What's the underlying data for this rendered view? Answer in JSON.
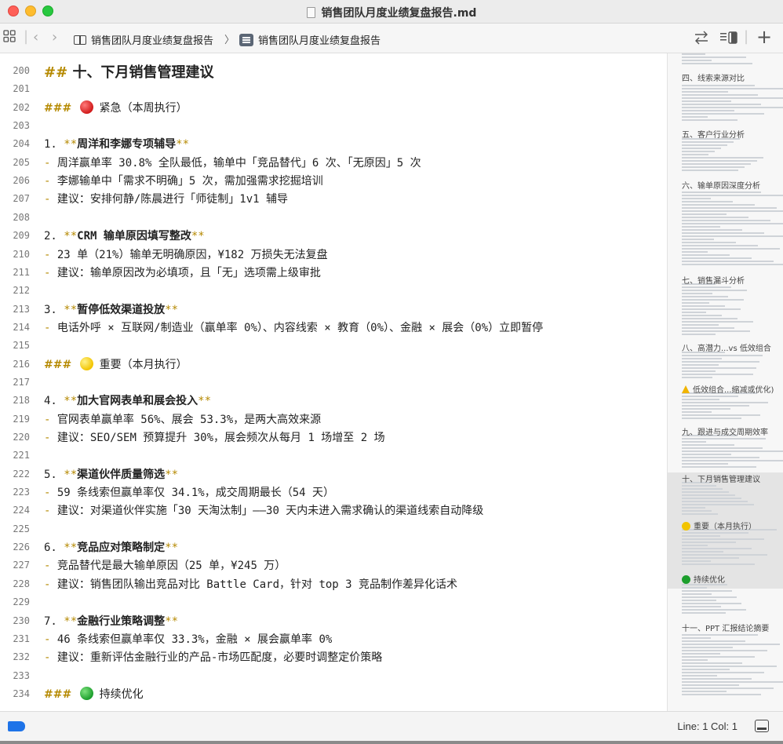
{
  "window": {
    "title": "销售团队月度业绩复盘报告.md"
  },
  "toolbar": {
    "breadcrumb_1": "销售团队月度业绩复盘报告",
    "breadcrumb_sep": "〉",
    "breadcrumb_2": "销售团队月度业绩复盘报告",
    "plus_label": "+"
  },
  "editor": {
    "lines": [
      {
        "n": "200",
        "type": "h2",
        "mark": "##",
        "text": "十、下月销售管理建议"
      },
      {
        "n": "201",
        "type": "blank"
      },
      {
        "n": "202",
        "type": "h3",
        "mark": "###",
        "dot": "red",
        "text": "紧急（本周执行）"
      },
      {
        "n": "203",
        "type": "blank"
      },
      {
        "n": "204",
        "type": "item",
        "num": "1.",
        "text": "周洋和李娜专项辅导"
      },
      {
        "n": "205",
        "type": "sub",
        "text": "周洋赢单率 30.8% 全队最低，输单中「竞品替代」6 次、「无原因」5 次"
      },
      {
        "n": "206",
        "type": "sub",
        "text": "李娜输单中「需求不明确」5 次，需加强需求挖掘培训"
      },
      {
        "n": "207",
        "type": "sub",
        "text": "建议：安排何静/陈晨进行「师徒制」1v1 辅导"
      },
      {
        "n": "208",
        "type": "blank"
      },
      {
        "n": "209",
        "type": "item",
        "num": "2.",
        "text": "CRM 输单原因填写整改"
      },
      {
        "n": "210",
        "type": "sub",
        "text": "23 单（21%）输单无明确原因，¥182 万损失无法复盘"
      },
      {
        "n": "211",
        "type": "sub",
        "text": "建议：输单原因改为必填项，且「无」选项需上级审批"
      },
      {
        "n": "212",
        "type": "blank"
      },
      {
        "n": "213",
        "type": "item",
        "num": "3.",
        "text": "暂停低效渠道投放"
      },
      {
        "n": "214",
        "type": "sub",
        "text": "电话外呼 × 互联网/制造业（赢单率 0%）、内容线索 × 教育（0%）、金融 × 展会（0%）立即暂停"
      },
      {
        "n": "215",
        "type": "blank"
      },
      {
        "n": "216",
        "type": "h3",
        "mark": "###",
        "dot": "yellow",
        "text": "重要（本月执行）"
      },
      {
        "n": "217",
        "type": "blank"
      },
      {
        "n": "218",
        "type": "item",
        "num": "4.",
        "text": "加大官网表单和展会投入"
      },
      {
        "n": "219",
        "type": "sub",
        "text": "官网表单赢单率 56%、展会 53.3%，是两大高效来源"
      },
      {
        "n": "220",
        "type": "sub",
        "text": "建议：SEO/SEM 预算提升 30%，展会频次从每月 1 场增至 2 场"
      },
      {
        "n": "221",
        "type": "blank"
      },
      {
        "n": "222",
        "type": "item",
        "num": "5.",
        "text": "渠道伙伴质量筛选"
      },
      {
        "n": "223",
        "type": "sub",
        "text": "59 条线索但赢单率仅 34.1%，成交周期最长（54 天）"
      },
      {
        "n": "224",
        "type": "sub",
        "text": "建议：对渠道伙伴实施「30 天淘汰制」——30 天内未进入需求确认的渠道线索自动降级"
      },
      {
        "n": "225",
        "type": "blank"
      },
      {
        "n": "226",
        "type": "item",
        "num": "6.",
        "text": "竞品应对策略制定"
      },
      {
        "n": "227",
        "type": "sub",
        "text": "竞品替代是最大输单原因（25 单，¥245 万）"
      },
      {
        "n": "228",
        "type": "sub",
        "text": "建议：销售团队输出竞品对比 Battle Card，针对 top 3 竞品制作差异化话术"
      },
      {
        "n": "229",
        "type": "blank"
      },
      {
        "n": "230",
        "type": "item",
        "num": "7.",
        "text": "金融行业策略调整"
      },
      {
        "n": "231",
        "type": "sub",
        "text": "46 条线索但赢单率仅 33.3%，金融 × 展会赢单率 0%"
      },
      {
        "n": "232",
        "type": "sub",
        "text": "建议：重新评估金融行业的产品-市场匹配度，必要时调整定价策略"
      },
      {
        "n": "233",
        "type": "blank"
      },
      {
        "n": "234",
        "type": "h3",
        "mark": "###",
        "dot": "green",
        "text": "持续优化"
      }
    ]
  },
  "minimap": {
    "sections": [
      "四、线索来源对比",
      "五、客户行业分析",
      "六、输单原因深度分析",
      "七、销售漏斗分析",
      "八、高潜力...vs 低效组合",
      "低效组合...缩减或优化)",
      "九、跟进与成交周期效率",
      "十、下月销售管理建议",
      "重要（本月执行）",
      "持续优化",
      "十一、PPT 汇报结论摘要"
    ]
  },
  "status": {
    "text": "Line: 1  Col: 1"
  },
  "colors": {
    "accent": "#1e73e8",
    "markdown_mark": "#b58900"
  }
}
